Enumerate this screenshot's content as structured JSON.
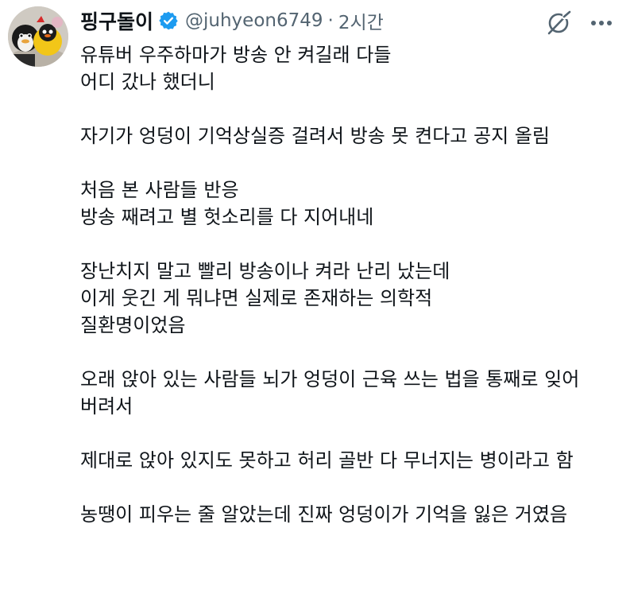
{
  "tweet": {
    "author": {
      "display_name": "핑구돌이",
      "handle": "@juhyeon6749",
      "verified": true
    },
    "separator": "·",
    "time": "2시간",
    "icons": {
      "verified": "verified-badge-icon",
      "grok": "grok-icon",
      "more": "more-icon"
    },
    "colors": {
      "verified_blue": "#1d9bf0",
      "secondary_text": "#536471",
      "primary_text": "#0f1419"
    },
    "paragraphs": [
      [
        "유튜버 우주하마가 방송 안 켜길래 다들",
        "어디 갔나 했더니"
      ],
      [
        "자기가 엉덩이 기억상실증 걸려서 방송 못 켠다고 공지 올림"
      ],
      [
        "처음 본 사람들 반응",
        "방송 째려고 별 헛소리를 다 지어내네"
      ],
      [
        "장난치지 말고 빨리 방송이나 켜라 난리 났는데",
        "이게 웃긴 게 뭐냐면 실제로 존재하는 의학적",
        "질환명이었음"
      ],
      [
        "오래 앉아 있는 사람들 뇌가 엉덩이 근육 쓰는 법을 통째로 잊어",
        "버려서"
      ],
      [
        "제대로 앉아 있지도 못하고 허리 골반 다 무너지는 병이라고 함"
      ],
      [
        "농땡이 피우는 줄 알았는데 진짜 엉덩이가 기억을 잃은 거였음"
      ]
    ]
  }
}
